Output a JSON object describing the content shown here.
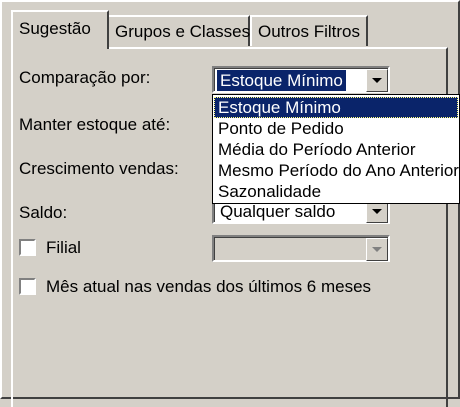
{
  "tabs": [
    {
      "label": "Sugestão",
      "active": true
    },
    {
      "label": "Grupos e Classes",
      "active": false
    },
    {
      "label": "Outros Filtros",
      "active": false
    }
  ],
  "fields": {
    "comparacao": {
      "label": "Comparação por:",
      "value": "Estoque Mínimo"
    },
    "manter": {
      "label": "Manter estoque até:"
    },
    "crescimento": {
      "label": "Crescimento vendas:"
    },
    "saldo": {
      "label": "Saldo:",
      "value": "Qualquer saldo"
    }
  },
  "checkboxes": {
    "filial": {
      "label": "Filial",
      "checked": false
    },
    "mes_atual": {
      "label": "Mês atual nas vendas dos últimos 6 meses",
      "checked": false
    }
  },
  "dropdown": {
    "options": [
      "Estoque Mínimo",
      "Ponto de Pedido",
      "Média do Período Anterior",
      "Mesmo Período do Ano Anterior",
      "Sazonalidade"
    ],
    "selected": "Estoque Mínimo"
  },
  "colors": {
    "face": "#d4d0c8",
    "highlight": "#0a246a"
  },
  "icons": [
    "chevron-down-icon"
  ]
}
